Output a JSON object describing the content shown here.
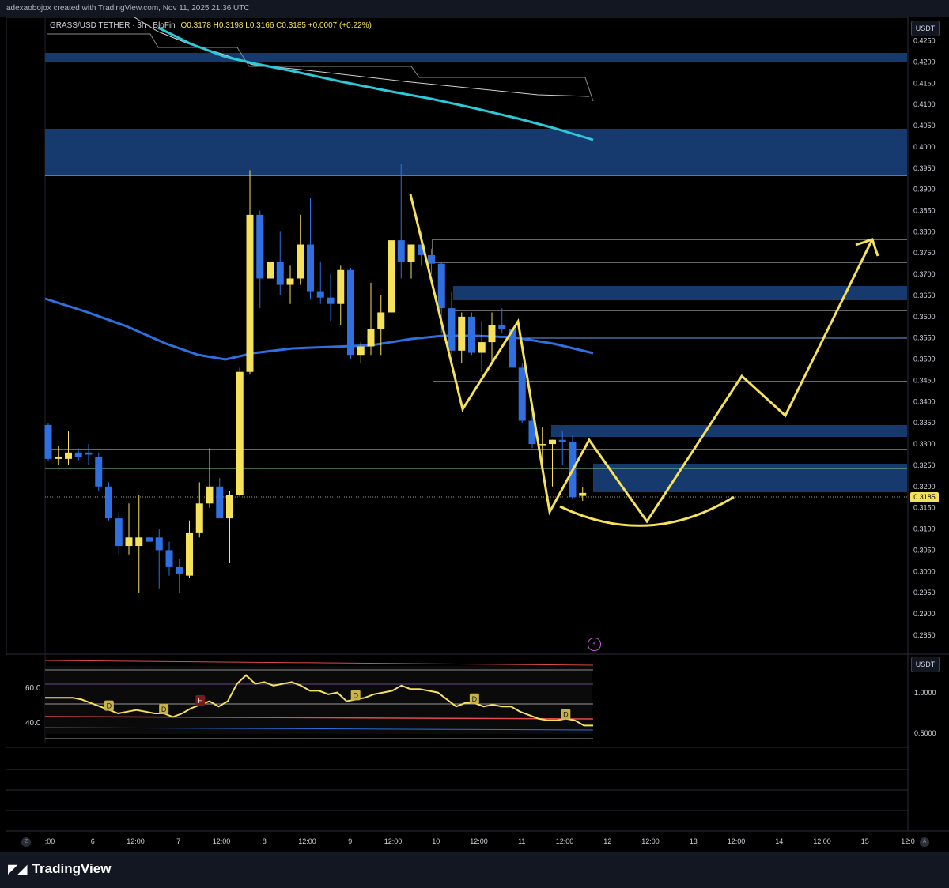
{
  "header": {
    "credit": "adexaobojox created with TradingView.com, Nov 11, 2025 21:36 UTC"
  },
  "legend": {
    "symbol": "GRASS/USD TETHER · 3h · BloFin",
    "ohlc": "O0.3178  H0.3198  L0.3166  C0.3185  +0.0007 (+0.22%)"
  },
  "units": {
    "main": "USDT",
    "indicator": "USDT"
  },
  "last_price": "0.3185",
  "branding": "TradingView",
  "colors": {
    "bull": "#f5e15a",
    "bear": "#2f6fe0",
    "ma_long": "#2ec8d8",
    "ma_mid": "#2f6fe0",
    "zone": "#173a6e",
    "drawing": "#f5e15a"
  },
  "chart_data": {
    "type": "candlestick",
    "interval": "3h",
    "ylim": [
      0.282,
      0.4305
    ],
    "x_ticks": [
      ":00",
      "6",
      "12:00",
      "7",
      "12:00",
      "8",
      "12:00",
      "9",
      "12:00",
      "10",
      "12:00",
      "11",
      "12:00",
      "12",
      "12:00",
      "13",
      "12:00",
      "14",
      "12:00",
      "15",
      "12:0"
    ],
    "y_ticks": [
      "0.4250",
      "0.4200",
      "0.4150",
      "0.4100",
      "0.4050",
      "0.4000",
      "0.3950",
      "0.3900",
      "0.3850",
      "0.3800",
      "0.3750",
      "0.3700",
      "0.3650",
      "0.3600",
      "0.3550",
      "0.3500",
      "0.3450",
      "0.3400",
      "0.3350",
      "0.3300",
      "0.3250",
      "0.3200",
      "0.3150",
      "0.3100",
      "0.3050",
      "0.3000",
      "0.2950",
      "0.2900",
      "0.2850"
    ],
    "candles": [
      {
        "o": 0.3345,
        "h": 0.335,
        "l": 0.326,
        "c": 0.3265
      },
      {
        "o": 0.3265,
        "h": 0.3295,
        "l": 0.325,
        "c": 0.327
      },
      {
        "o": 0.3265,
        "h": 0.333,
        "l": 0.325,
        "c": 0.328
      },
      {
        "o": 0.328,
        "h": 0.329,
        "l": 0.326,
        "c": 0.327
      },
      {
        "o": 0.328,
        "h": 0.33,
        "l": 0.325,
        "c": 0.3275
      },
      {
        "o": 0.327,
        "h": 0.328,
        "l": 0.319,
        "c": 0.32
      },
      {
        "o": 0.32,
        "h": 0.321,
        "l": 0.312,
        "c": 0.3125
      },
      {
        "o": 0.3125,
        "h": 0.314,
        "l": 0.304,
        "c": 0.306
      },
      {
        "o": 0.306,
        "h": 0.316,
        "l": 0.304,
        "c": 0.308
      },
      {
        "o": 0.306,
        "h": 0.318,
        "l": 0.295,
        "c": 0.308
      },
      {
        "o": 0.308,
        "h": 0.313,
        "l": 0.305,
        "c": 0.307
      },
      {
        "o": 0.308,
        "h": 0.31,
        "l": 0.296,
        "c": 0.305
      },
      {
        "o": 0.305,
        "h": 0.307,
        "l": 0.299,
        "c": 0.301
      },
      {
        "o": 0.301,
        "h": 0.303,
        "l": 0.295,
        "c": 0.2995
      },
      {
        "o": 0.299,
        "h": 0.312,
        "l": 0.2985,
        "c": 0.309
      },
      {
        "o": 0.309,
        "h": 0.321,
        "l": 0.308,
        "c": 0.316
      },
      {
        "o": 0.316,
        "h": 0.329,
        "l": 0.315,
        "c": 0.32
      },
      {
        "o": 0.32,
        "h": 0.322,
        "l": 0.316,
        "c": 0.3125
      },
      {
        "o": 0.3125,
        "h": 0.319,
        "l": 0.302,
        "c": 0.318
      },
      {
        "o": 0.318,
        "h": 0.348,
        "l": 0.3175,
        "c": 0.347
      },
      {
        "o": 0.347,
        "h": 0.3945,
        "l": 0.3465,
        "c": 0.384
      },
      {
        "o": 0.384,
        "h": 0.385,
        "l": 0.362,
        "c": 0.369
      },
      {
        "o": 0.369,
        "h": 0.3755,
        "l": 0.36,
        "c": 0.373
      },
      {
        "o": 0.373,
        "h": 0.38,
        "l": 0.365,
        "c": 0.3675
      },
      {
        "o": 0.3675,
        "h": 0.372,
        "l": 0.363,
        "c": 0.369
      },
      {
        "o": 0.369,
        "h": 0.384,
        "l": 0.3675,
        "c": 0.377
      },
      {
        "o": 0.377,
        "h": 0.388,
        "l": 0.364,
        "c": 0.366
      },
      {
        "o": 0.366,
        "h": 0.373,
        "l": 0.363,
        "c": 0.3645
      },
      {
        "o": 0.3645,
        "h": 0.37,
        "l": 0.359,
        "c": 0.363
      },
      {
        "o": 0.363,
        "h": 0.372,
        "l": 0.358,
        "c": 0.371
      },
      {
        "o": 0.371,
        "h": 0.3715,
        "l": 0.35,
        "c": 0.351
      },
      {
        "o": 0.351,
        "h": 0.354,
        "l": 0.349,
        "c": 0.353
      },
      {
        "o": 0.353,
        "h": 0.368,
        "l": 0.351,
        "c": 0.357
      },
      {
        "o": 0.357,
        "h": 0.365,
        "l": 0.351,
        "c": 0.361
      },
      {
        "o": 0.361,
        "h": 0.384,
        "l": 0.351,
        "c": 0.378
      },
      {
        "o": 0.378,
        "h": 0.396,
        "l": 0.369,
        "c": 0.373
      },
      {
        "o": 0.373,
        "h": 0.377,
        "l": 0.369,
        "c": 0.377
      },
      {
        "o": 0.377,
        "h": 0.38,
        "l": 0.372,
        "c": 0.3745
      },
      {
        "o": 0.3745,
        "h": 0.376,
        "l": 0.37,
        "c": 0.3725
      },
      {
        "o": 0.3725,
        "h": 0.373,
        "l": 0.356,
        "c": 0.362
      },
      {
        "o": 0.362,
        "h": 0.366,
        "l": 0.351,
        "c": 0.352
      },
      {
        "o": 0.352,
        "h": 0.361,
        "l": 0.349,
        "c": 0.36
      },
      {
        "o": 0.36,
        "h": 0.361,
        "l": 0.351,
        "c": 0.3515
      },
      {
        "o": 0.3515,
        "h": 0.359,
        "l": 0.347,
        "c": 0.354
      },
      {
        "o": 0.354,
        "h": 0.361,
        "l": 0.349,
        "c": 0.358
      },
      {
        "o": 0.358,
        "h": 0.362,
        "l": 0.356,
        "c": 0.357
      },
      {
        "o": 0.357,
        "h": 0.358,
        "l": 0.347,
        "c": 0.348
      },
      {
        "o": 0.348,
        "h": 0.349,
        "l": 0.335,
        "c": 0.3355
      },
      {
        "o": 0.3355,
        "h": 0.34,
        "l": 0.329,
        "c": 0.33
      },
      {
        "o": 0.33,
        "h": 0.334,
        "l": 0.324,
        "c": 0.33
      },
      {
        "o": 0.33,
        "h": 0.331,
        "l": 0.32,
        "c": 0.331
      },
      {
        "o": 0.331,
        "h": 0.333,
        "l": 0.325,
        "c": 0.3305
      },
      {
        "o": 0.3305,
        "h": 0.332,
        "l": 0.317,
        "c": 0.3175
      },
      {
        "o": 0.3178,
        "h": 0.3198,
        "l": 0.3166,
        "c": 0.3185
      }
    ],
    "indicator": {
      "y_ticks": [
        "1.0000",
        "0.5000"
      ],
      "left_labels": [
        "60.0",
        "40.0"
      ],
      "line": [
        54,
        54,
        54,
        54,
        53,
        51,
        49,
        47,
        45,
        46,
        47,
        46,
        45,
        45,
        43,
        45,
        48,
        50,
        52,
        49,
        52,
        62,
        67,
        62,
        63,
        61,
        62,
        63,
        61,
        58,
        58,
        56,
        57,
        52,
        53,
        54,
        56,
        57,
        58,
        61,
        59,
        59,
        58,
        57,
        53,
        49,
        51,
        51,
        49,
        50,
        49,
        49,
        46,
        44,
        42,
        41,
        41,
        42,
        41,
        38,
        38
      ],
      "markers": [
        {
          "label": "D",
          "idx": 7
        },
        {
          "label": "D",
          "idx": 13
        },
        {
          "label": "H",
          "idx": 17
        },
        {
          "label": "D",
          "idx": 34
        },
        {
          "label": "D",
          "idx": 47
        },
        {
          "label": "D",
          "idx": 57
        }
      ]
    }
  }
}
